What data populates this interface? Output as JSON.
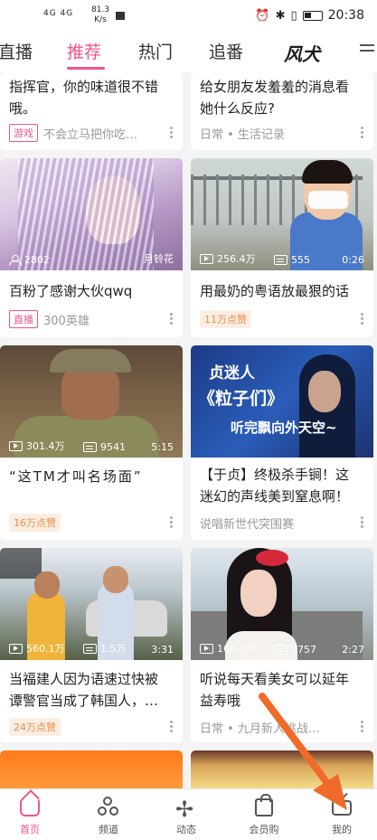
{
  "status_bar": {
    "network": "4G  4G",
    "speed_value": "81.3",
    "speed_unit": "K/s",
    "time": "20:38"
  },
  "tabs": [
    {
      "label": "直播"
    },
    {
      "label": "推荐"
    },
    {
      "label": "热门"
    },
    {
      "label": "追番"
    },
    {
      "label": "风犬"
    }
  ],
  "cards": [
    {
      "title": "指挥官，你的味道很不错哦。",
      "tag": "游戏",
      "meta": "不会立马把你吃…"
    },
    {
      "title": "给女朋友发羞羞的消息看她什么反应?",
      "meta": "日常 • 生活记录"
    },
    {
      "title": "百粉了感谢大伙qwq",
      "tag": "直播",
      "meta": "300英雄",
      "views": "2802",
      "right": "月铃花"
    },
    {
      "title": "用最奶的粤语放最狠的话",
      "tag": "11万点赞",
      "views": "256.4万",
      "danmaku": "555",
      "duration": "0:26"
    },
    {
      "title": "“这TM才叫名场面”",
      "tag": "16万点赞",
      "views": "301.4万",
      "danmaku": "9541",
      "duration": "5:15"
    },
    {
      "title": "【于贞】终极杀手锏！这迷幻的声线美到窒息啊！",
      "meta": "说唱新世代突围赛",
      "thumb_line1": "贞迷人",
      "thumb_line2": "《粒子们》",
      "thumb_line3": "听完飘向外天空~"
    },
    {
      "title": "当福建人因为语速过快被谭警官当成了韩国人，…",
      "tag": "24万点赞",
      "views": "560.1万",
      "danmaku": "1.5万",
      "duration": "3:31"
    },
    {
      "title": "听说每天看美女可以延年益寿哦",
      "meta": "日常 • 九月新人挑战…",
      "views": "166.1万",
      "danmaku": "2757",
      "duration": "2:27"
    }
  ],
  "bottom_nav": [
    {
      "label": "首页"
    },
    {
      "label": "频道"
    },
    {
      "label": "动态"
    },
    {
      "label": "会员购"
    },
    {
      "label": "我的"
    }
  ],
  "colors": {
    "accent": "#f0548c",
    "arrow": "#f06a2a"
  }
}
